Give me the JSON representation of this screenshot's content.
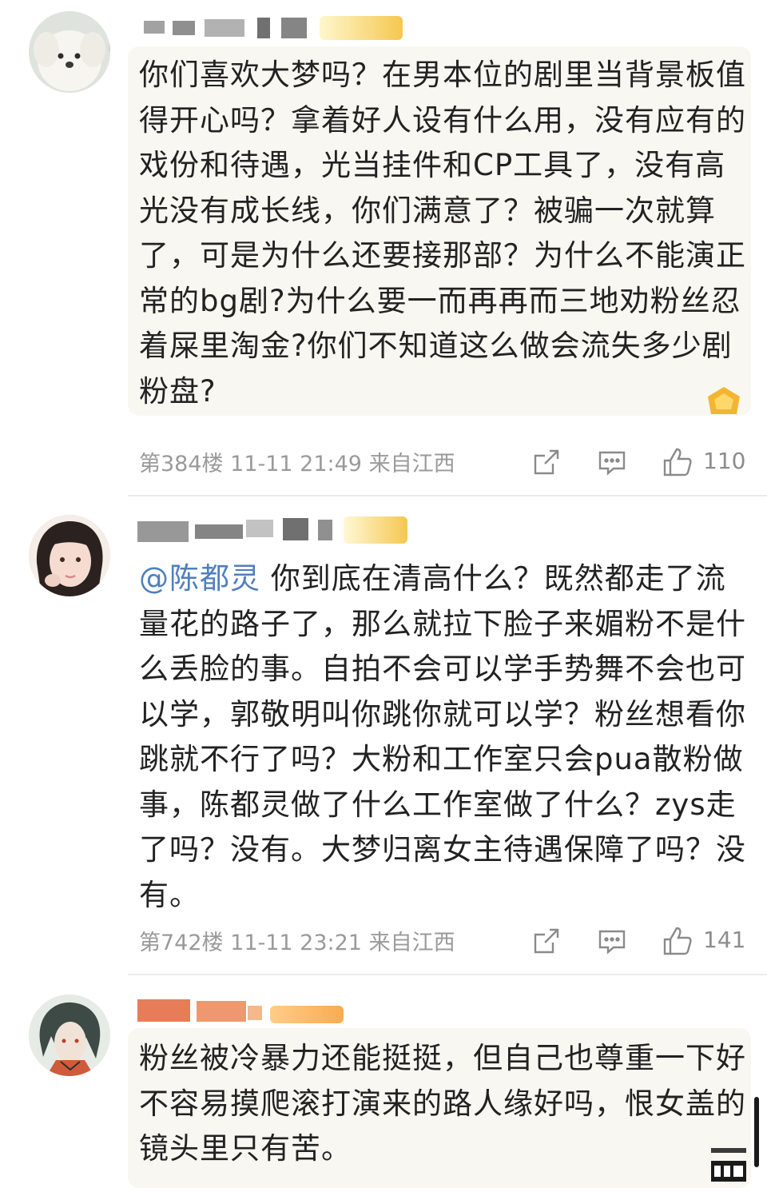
{
  "comments": [
    {
      "text": "你们喜欢大梦吗？在男本位的剧里当背景板值得开心吗？拿着好人设有什么用，没有应有的戏份和待遇，光当挂件和CP工具了，没有高光没有成长线，你们满意了？被骗一次就算了，可是为什么还要接那部？为什么不能演正常的bg剧?为什么要一而再再而三地劝粉丝忍着屎里淘金?你们不知道这么做会流失多少剧粉盘?",
      "floor": "第384楼",
      "time": "11-11 21:49",
      "location": "来自江西",
      "likes": "110"
    },
    {
      "mention": "@陈都灵",
      "text": " 你到底在清高什么？既然都走了流量花的路子了，那么就拉下脸子来媚粉不是什么丢脸的事。自拍不会可以学手势舞不会也可以学，郭敬明叫你跳你就可以学？粉丝想看你跳就不行了吗？大粉和工作室只会pua散粉做事，陈都灵做了什么工作室做了什么？zys走了吗？没有。大梦归离女主待遇保障了吗？没有。",
      "floor": "第742楼",
      "time": "11-11 23:21",
      "location": "来自江西",
      "likes": "141"
    },
    {
      "text": "粉丝被冷暴力还能挺挺，但自己也尊重一下好不容易摸爬滚打演来的路人缘好吗，恨女盖的镜头里只有苦。"
    }
  ],
  "icons": [
    "share-icon",
    "comment-icon",
    "like-icon"
  ],
  "colors": {
    "mention": "#4f7fbf",
    "meta": "#9a9a9a",
    "bubble": "#f8f7f1"
  }
}
